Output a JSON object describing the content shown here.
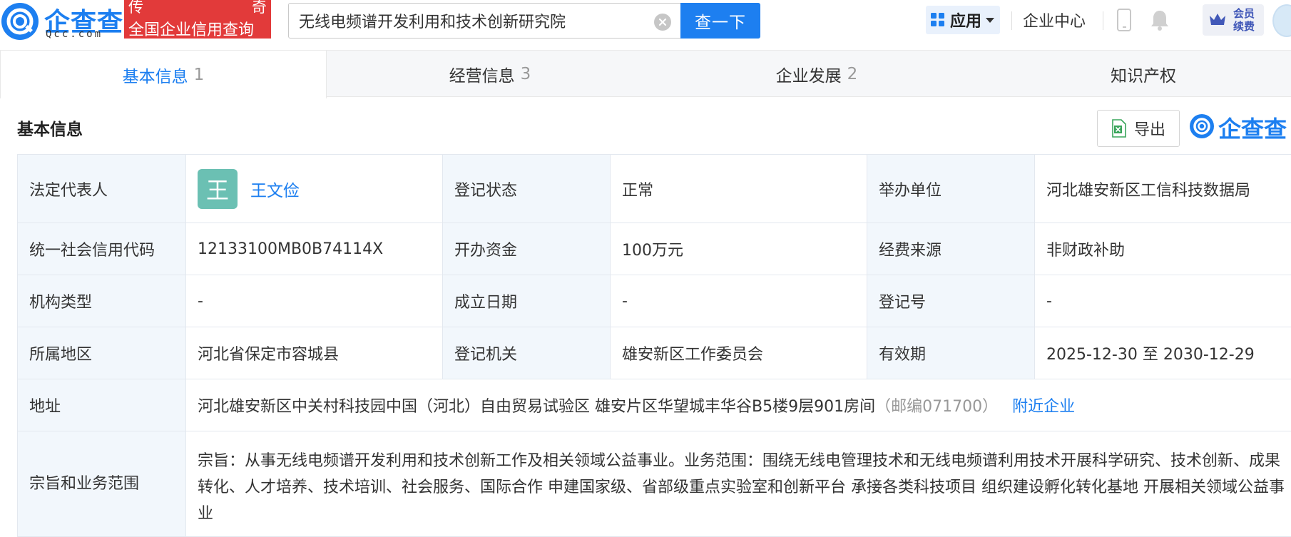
{
  "header": {
    "logo_name": "企查查",
    "logo_domain": "Qcc.com",
    "banner_line1_left": "传",
    "banner_line1_right": "奇",
    "banner_line2": "全国企业信用查询",
    "search_value": "无线电频谱开发利用和技术创新研究院",
    "search_button": "查一下",
    "apps_label": "应用",
    "enterprise_center": "企业中心",
    "vip_line1": "会员",
    "vip_line2": "续费"
  },
  "tabs": [
    {
      "label": "基本信息",
      "count": "1"
    },
    {
      "label": "经营信息",
      "count": "3"
    },
    {
      "label": "企业发展",
      "count": "2"
    },
    {
      "label": "知识产权",
      "count": ""
    }
  ],
  "section": {
    "title": "基本信息",
    "export_label": "导出",
    "brand": "企查查"
  },
  "info": {
    "legal_rep_label": "法定代表人",
    "legal_rep_avatar": "王",
    "legal_rep_name": "王文俭",
    "reg_status_label": "登记状态",
    "reg_status": "正常",
    "organizer_label": "举办单位",
    "organizer": "河北雄安新区工信科技数据局",
    "credit_code_label": "统一社会信用代码",
    "credit_code": "12133100MB0B74114X",
    "capital_label": "开办资金",
    "capital": "100万元",
    "funding_label": "经费来源",
    "funding": "非财政补助",
    "org_type_label": "机构类型",
    "org_type": "-",
    "found_date_label": "成立日期",
    "found_date": "-",
    "reg_no_label": "登记号",
    "reg_no": "-",
    "region_label": "所属地区",
    "region": "河北省保定市容城县",
    "reg_authority_label": "登记机关",
    "reg_authority": "雄安新区工作委员会",
    "validity_label": "有效期",
    "validity": "2025-12-30 至 2030-12-29",
    "address_label": "地址",
    "address": "河北雄安新区中关村科技园中国（河北）自由贸易试验区 雄安片区华望城丰华谷B5楼9层901房间",
    "postal": "（邮编071700）",
    "nearby_link": "附近企业",
    "purpose_label": "宗旨和业务范围",
    "purpose": "宗旨：从事无线电频谱开发利用和技术创新工作及相关领域公益事业。业务范围：围绕无线电管理技术和无线电频谱利用技术开展科学研究、技术创新、成果转化、人才培养、技术培训、社会服务、国际合作 申建国家级、省部级重点实验室和创新平台 承接各类科技项目 组织建设孵化转化基地 开展相关领域公益事业"
  },
  "colors": {
    "accent": "#1d7ff0",
    "banner": "#e23a3a",
    "label_bg": "#f2f7fc",
    "avatar_bg": "#6bc0b3"
  }
}
